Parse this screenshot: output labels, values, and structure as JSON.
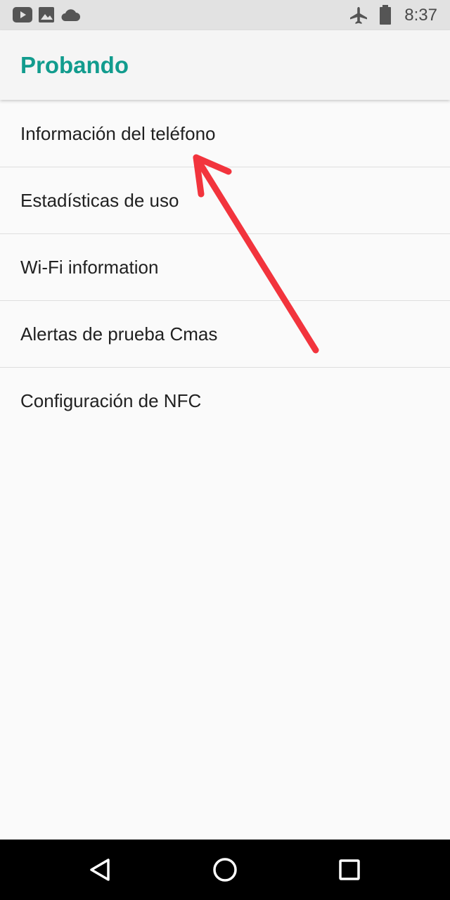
{
  "status_bar": {
    "left_icons": [
      "youtube-icon",
      "image-icon",
      "cloud-icon"
    ],
    "right_icons": [
      "airplane-mode-icon",
      "battery-icon"
    ],
    "time": "8:37"
  },
  "app_bar": {
    "title": "Probando"
  },
  "menu": {
    "items": [
      {
        "label": "Información del teléfono"
      },
      {
        "label": "Estadísticas de uso"
      },
      {
        "label": "Wi-Fi information"
      },
      {
        "label": "Alertas de prueba Cmas"
      },
      {
        "label": "Configuración de NFC"
      }
    ]
  },
  "annotation": {
    "type": "arrow",
    "color": "#f2343d",
    "points_to": "Información del teléfono"
  },
  "nav_bar": {
    "buttons": [
      "back-icon",
      "home-icon",
      "recents-icon"
    ]
  },
  "colors": {
    "accent": "#129c8e",
    "status_bar_bg": "#e2e2e2",
    "background": "#fafafa"
  }
}
